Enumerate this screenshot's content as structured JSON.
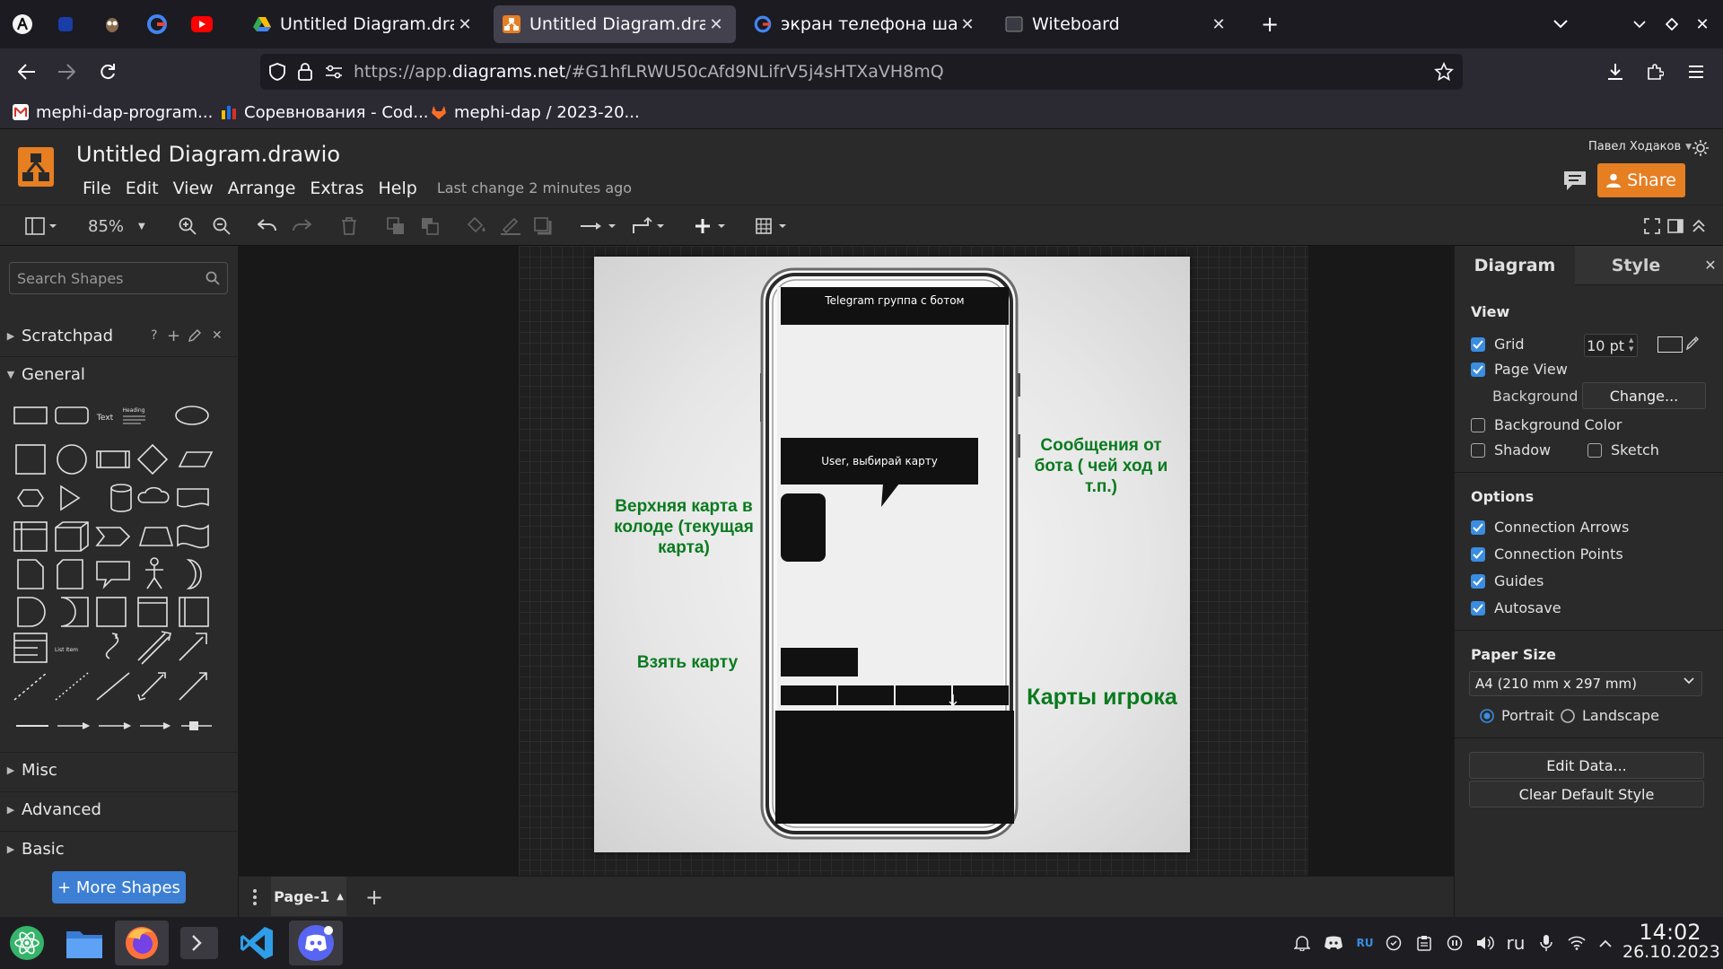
{
  "browser": {
    "tabs": [
      {
        "title": "Untitled Diagram.drawio",
        "active": false
      },
      {
        "title": "Untitled Diagram.drawio",
        "active": true
      },
      {
        "title": "экран телефона шаблон",
        "active": false
      },
      {
        "title": "Witeboard",
        "active": false
      }
    ],
    "url_prefix": "https://app.",
    "url_domain": "diagrams.net",
    "url_rest": "/#G1hfLRWU50cAfd9NLifrV5j4sHTXaVH8mQ",
    "bookmarks": [
      "mephi-dap-program...",
      "Соревнования - Cod...",
      "mephi-dap / 2023-20..."
    ]
  },
  "app": {
    "doc_title": "Untitled Diagram.drawio",
    "menus": [
      "File",
      "Edit",
      "View",
      "Arrange",
      "Extras",
      "Help"
    ],
    "last_change": "Last change 2 minutes ago",
    "user": "Павел Ходаков",
    "share_label": "Share",
    "zoom": "85%"
  },
  "sidebar": {
    "search_placeholder": "Search Shapes",
    "scratchpad": "Scratchpad",
    "scratch_help": "?",
    "general": "General",
    "sections": [
      "Misc",
      "Advanced",
      "Basic"
    ],
    "more_shapes": "+ More Shapes",
    "text_shape": "Text",
    "heading_shape": "Heading",
    "list_item_shape": "List Item"
  },
  "diagram": {
    "phone_header": "Telegram группа с ботом",
    "bubble_text": "User, выбирай карту",
    "label_messages": "Сообщения от бота ( чей ход и т.п.)",
    "label_top_card": "Верхняя карта в колоде (текущая карта)",
    "label_take_card": "Взять карту",
    "label_player_cards": "Карты игрока"
  },
  "pages": {
    "current": "Page-1"
  },
  "format_panel": {
    "tabs": [
      "Diagram",
      "Style"
    ],
    "view_heading": "View",
    "grid": {
      "label": "Grid",
      "checked": true,
      "size": "10 pt"
    },
    "page_view": {
      "label": "Page View",
      "checked": true
    },
    "background_label": "Background",
    "change_button": "Change...",
    "background_color": {
      "label": "Background Color",
      "checked": false
    },
    "shadow": {
      "label": "Shadow",
      "checked": false
    },
    "sketch": {
      "label": "Sketch",
      "checked": false
    },
    "options_heading": "Options",
    "options": [
      {
        "label": "Connection Arrows",
        "checked": true
      },
      {
        "label": "Connection Points",
        "checked": true
      },
      {
        "label": "Guides",
        "checked": true
      },
      {
        "label": "Autosave",
        "checked": true
      }
    ],
    "paper_heading": "Paper Size",
    "paper_size": "A4 (210 mm x 297 mm)",
    "portrait": "Portrait",
    "landscape": "Landscape",
    "orientation": "Portrait",
    "edit_data": "Edit Data...",
    "clear_style": "Clear Default Style"
  },
  "taskbar": {
    "lang": "RU",
    "kbd": "ru",
    "time": "14:02",
    "date": "26.10.2023"
  },
  "colors": {
    "accent_orange": "#e67e22",
    "label_green": "#0a7a1f",
    "checkbox_blue": "#3a8de0",
    "more_shapes_blue": "#3c7fd4"
  }
}
